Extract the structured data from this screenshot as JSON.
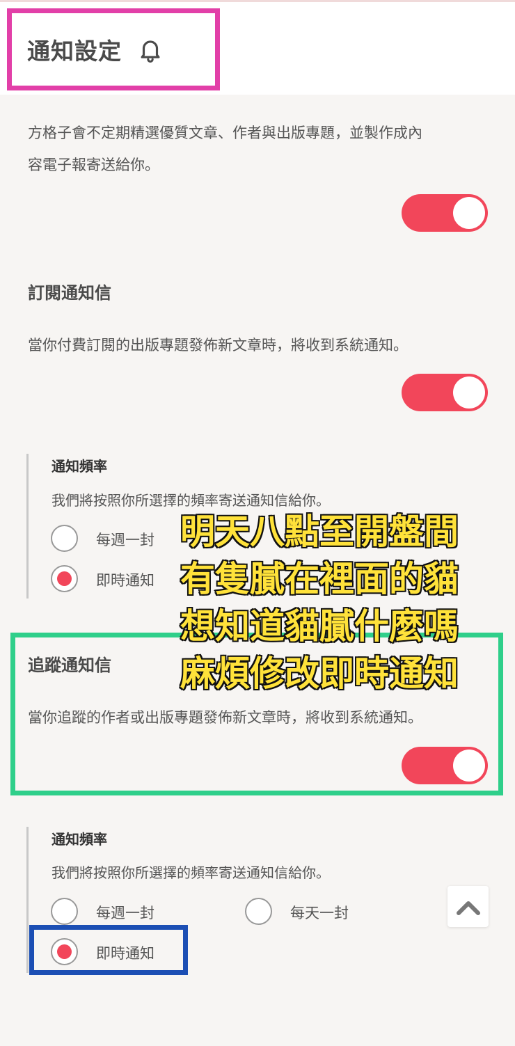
{
  "header": {
    "title": "通知設定",
    "icon": "bell-icon"
  },
  "newsletter": {
    "description_line1": "方格子會不定期精選優質文章、作者與出版專題，並製作成內",
    "description_line2": "容電子報寄送給你。",
    "enabled": true
  },
  "subscription": {
    "title": "訂閱通知信",
    "description": "當你付費訂閱的出版專題發佈新文章時，將收到系統通知。",
    "enabled": true,
    "frequency": {
      "title": "通知頻率",
      "description": "我們將按照你所選擇的頻率寄送通知信給你。",
      "options": [
        "每週一封",
        "即時通知"
      ],
      "selected": "即時通知"
    }
  },
  "follow": {
    "title": "追蹤通知信",
    "description": "當你追蹤的作者或出版專題發佈新文章時，將收到系統通知。",
    "enabled": true,
    "frequency": {
      "title": "通知頻率",
      "description": "我們將按照你所選擇的頻率寄送通知信給你。",
      "options": [
        "每週一封",
        "每天一封",
        "即時通知"
      ],
      "selected": "即時通知"
    }
  },
  "overlay": {
    "lines": [
      "明天八點至開盤間",
      "有隻膩在裡面的貓",
      "想知道貓膩什麼嗎",
      "麻煩修改即時通知"
    ]
  },
  "colors": {
    "accent": "#f2465a",
    "annotation_pink": "#e23fa8",
    "annotation_green": "#2fcf8a",
    "annotation_blue": "#1c4fb4",
    "overlay_text": "#ffe23a"
  }
}
